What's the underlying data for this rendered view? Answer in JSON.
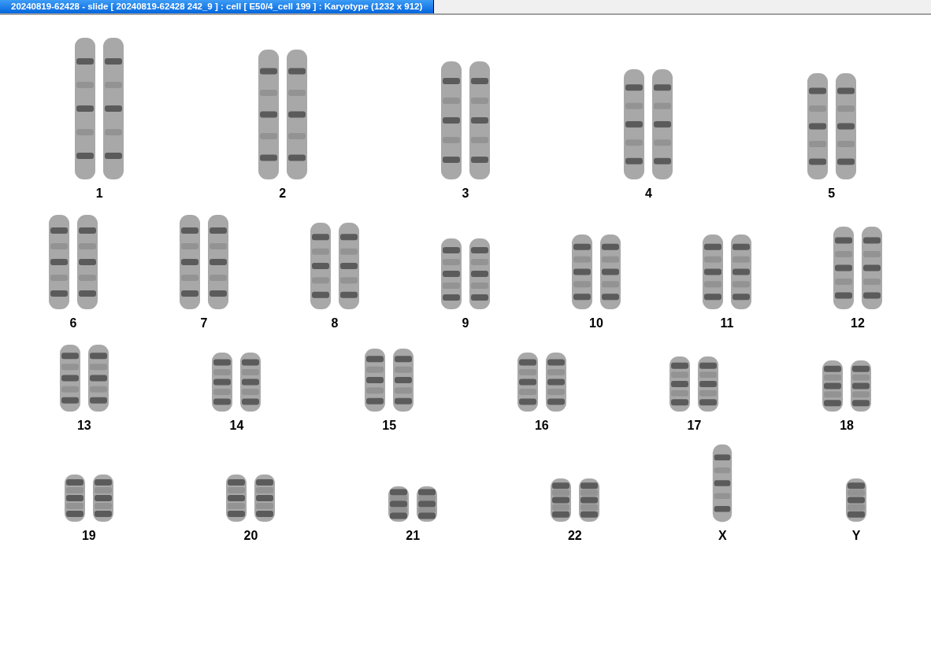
{
  "window": {
    "title": "20240819-62428 - slide [ 20240819-62428 242_9 ] : cell [ E50/4_cell 199 ] : Karyotype  (1232 x 912)"
  },
  "rows": [
    {
      "items": [
        {
          "label": "1",
          "kind": "pair"
        },
        {
          "label": "2",
          "kind": "pair"
        },
        {
          "label": "3",
          "kind": "pair"
        },
        {
          "label": "4",
          "kind": "pair"
        },
        {
          "label": "5",
          "kind": "pair"
        }
      ]
    },
    {
      "items": [
        {
          "label": "6",
          "kind": "pair"
        },
        {
          "label": "7",
          "kind": "pair"
        },
        {
          "label": "8",
          "kind": "pair"
        },
        {
          "label": "9",
          "kind": "pair"
        },
        {
          "label": "10",
          "kind": "pair"
        },
        {
          "label": "11",
          "kind": "pair"
        },
        {
          "label": "12",
          "kind": "pair"
        }
      ]
    },
    {
      "items": [
        {
          "label": "13",
          "kind": "pair"
        },
        {
          "label": "14",
          "kind": "pair"
        },
        {
          "label": "15",
          "kind": "pair"
        },
        {
          "label": "16",
          "kind": "pair"
        },
        {
          "label": "17",
          "kind": "pair"
        },
        {
          "label": "18",
          "kind": "pair"
        }
      ]
    },
    {
      "items": [
        {
          "label": "19",
          "kind": "pair"
        },
        {
          "label": "20",
          "kind": "pair"
        },
        {
          "label": "21",
          "kind": "pair"
        },
        {
          "label": "22",
          "kind": "pair"
        },
        {
          "label": "X",
          "kind": "single"
        },
        {
          "label": "Y",
          "kind": "single"
        }
      ]
    }
  ]
}
